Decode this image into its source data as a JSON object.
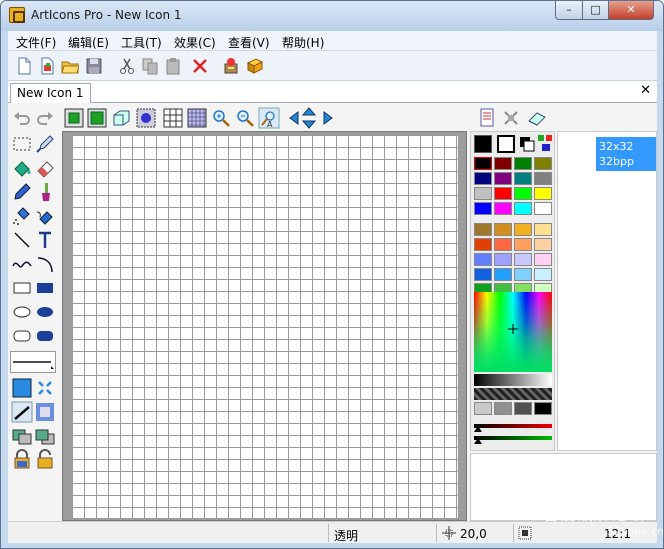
{
  "window": {
    "title": "ArtIcons Pro - New Icon 1",
    "min": "–",
    "max": "□",
    "close": "✕"
  },
  "menu": [
    "文件(F)",
    "编辑(E)",
    "工具(T)",
    "效果(C)",
    "查看(V)",
    "帮助(H)"
  ],
  "tab": {
    "label": "New Icon 1",
    "close": "✕"
  },
  "formats": {
    "size": "32x32",
    "depth": "32bpp"
  },
  "status": {
    "transparency": "透明",
    "coords": "20,0",
    "zoom": "12:1"
  },
  "watermark": {
    "main": "吾爱破解论坛",
    "url": "52pojie.cn"
  },
  "palette": {
    "primary": "#000000",
    "swatches": [
      [
        "#000000",
        "#800000",
        "#008000",
        "#808000"
      ],
      [
        "#000080",
        "#800080",
        "#008080",
        "#808080"
      ],
      [
        "#c0c0c0",
        "#ff0000",
        "#00ff00",
        "#ffff00"
      ],
      [
        "#0000ff",
        "#ff00ff",
        "#00ffff",
        "#ffffff"
      ],
      [
        "#a0782c",
        "#d09020",
        "#f0b020",
        "#ffe090"
      ],
      [
        "#e04000",
        "#ff6840",
        "#ffa060",
        "#ffd0a0"
      ],
      [
        "#6080ff",
        "#a0a0ff",
        "#c8c8ff",
        "#ffd0f0"
      ],
      [
        "#1060e0",
        "#20a0ff",
        "#80d0ff",
        "#c8f0ff"
      ],
      [
        "#10a020",
        "#40c040",
        "#80e060",
        "#d0ffc0"
      ]
    ],
    "grays": [
      "#c8c8c8",
      "#909090",
      "#505050",
      "#000000"
    ]
  }
}
